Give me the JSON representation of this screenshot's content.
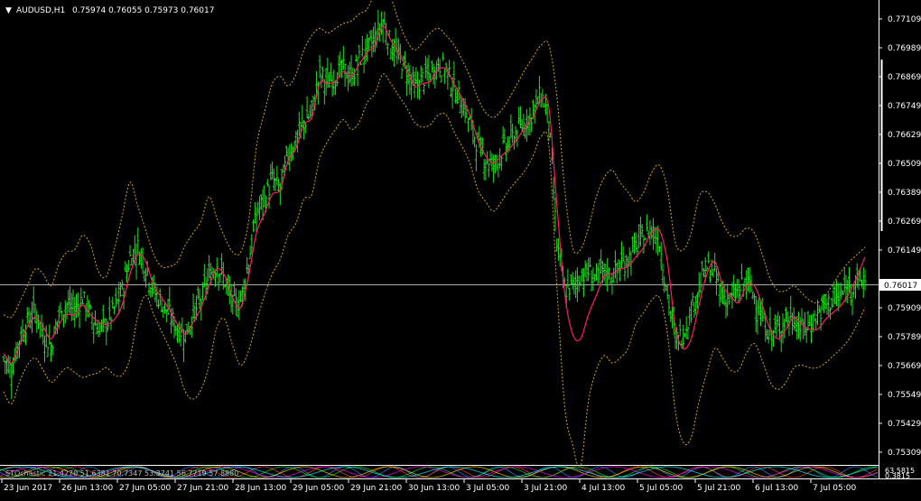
{
  "header": {
    "symbol_label": "AUDUSD,H1",
    "ohlc": "0.75974 0.76055 0.75973 0.76017",
    "dropdown_glyph": "▼"
  },
  "colors": {
    "background": "#000000",
    "candles": "#22dd22",
    "ma_line": "#ff1a6b",
    "bands": "#d8a520",
    "axis_text": "#ffffff",
    "grid_line": "#aaaaaa"
  },
  "price_axis": {
    "labels": [
      "0.77109",
      "0.76989",
      "0.76869",
      "0.76749",
      "0.76629",
      "0.76509",
      "0.76389",
      "0.76269",
      "0.76149",
      "0.75909",
      "0.75789",
      "0.75669",
      "0.75549",
      "0.75429",
      "0.75309"
    ],
    "current_price": "0.76017"
  },
  "time_axis": {
    "labels": [
      "23 Jun 2017",
      "26 Jun 13:00",
      "27 Jun 05:00",
      "27 Jun 21:00",
      "28 Jun 13:00",
      "29 Jun 05:00",
      "29 Jun 21:00",
      "30 Jun 13:00",
      "3 Jul 05:00",
      "3 Jul 21:00",
      "4 Jul 13:00",
      "5 Jul 05:00",
      "5 Jul 21:00",
      "6 Jul 13:00",
      "7 Jul 05:00"
    ]
  },
  "sub_indicator": {
    "text": "STOchastic 21.4270 51.6381 70.7347 53.3741 56.7719 57.8880",
    "right_top": "63.5815",
    "right_bottom": "0.3815"
  },
  "chart_data": {
    "type": "line",
    "title": "AUDUSD,H1",
    "y_ticks": [
      0.77109,
      0.76989,
      0.76869,
      0.76749,
      0.76629,
      0.76509,
      0.76389,
      0.76269,
      0.76149,
      0.75909,
      0.75789,
      0.75669,
      0.75549,
      0.75429,
      0.75309
    ],
    "ylim": [
      0.7526,
      0.7718
    ],
    "current_price": 0.76017,
    "series": [
      {
        "name": "ma",
        "type": "line",
        "values": [
          0.7572,
          0.7568,
          0.7575,
          0.7583,
          0.7587,
          0.7583,
          0.7578,
          0.7584,
          0.7588,
          0.7588,
          0.7592,
          0.7588,
          0.7585,
          0.7584,
          0.7586,
          0.7592,
          0.7605,
          0.7613,
          0.761,
          0.76,
          0.7595,
          0.759,
          0.7584,
          0.758,
          0.7585,
          0.7591,
          0.76,
          0.7607,
          0.7604,
          0.7595,
          0.7591,
          0.7604,
          0.7622,
          0.763,
          0.7638,
          0.764,
          0.7652,
          0.7657,
          0.7667,
          0.767,
          0.7684,
          0.7684,
          0.7685,
          0.7689,
          0.7687,
          0.7692,
          0.7697,
          0.77,
          0.7708,
          0.7702,
          0.7697,
          0.769,
          0.7683,
          0.7684,
          0.7685,
          0.769,
          0.769,
          0.7684,
          0.7678,
          0.7671,
          0.7661,
          0.7654,
          0.7651,
          0.7654,
          0.7657,
          0.7661,
          0.7666,
          0.767,
          0.7677,
          0.7674,
          0.7634,
          0.7597,
          0.758,
          0.7578,
          0.7588,
          0.7596,
          0.7604,
          0.7605,
          0.7607,
          0.7608,
          0.7612,
          0.7616,
          0.7622,
          0.7623,
          0.761,
          0.7583,
          0.7574,
          0.7578,
          0.7592,
          0.7605,
          0.761,
          0.76,
          0.7596,
          0.7593,
          0.76,
          0.76,
          0.7592,
          0.7582,
          0.7578,
          0.7582,
          0.7587,
          0.7584,
          0.7582,
          0.7582,
          0.7586,
          0.7589,
          0.7592,
          0.7597,
          0.7604,
          0.7612
        ]
      },
      {
        "name": "upper_band",
        "type": "line",
        "values": [
          0.7588,
          0.7587,
          0.7593,
          0.76,
          0.7607,
          0.7605,
          0.76,
          0.7609,
          0.7614,
          0.7615,
          0.7621,
          0.7617,
          0.7606,
          0.7604,
          0.7615,
          0.7629,
          0.7643,
          0.7633,
          0.7623,
          0.7613,
          0.7608,
          0.7608,
          0.761,
          0.7617,
          0.7622,
          0.7627,
          0.7637,
          0.7628,
          0.762,
          0.7614,
          0.7614,
          0.7627,
          0.7658,
          0.7672,
          0.7684,
          0.7687,
          0.7683,
          0.7688,
          0.7698,
          0.7704,
          0.7707,
          0.7705,
          0.7707,
          0.7709,
          0.771,
          0.7713,
          0.7715,
          0.7722,
          0.7728,
          0.772,
          0.771,
          0.7702,
          0.7698,
          0.7701,
          0.7705,
          0.7707,
          0.7704,
          0.77,
          0.7694,
          0.7687,
          0.7678,
          0.7672,
          0.767,
          0.7673,
          0.7678,
          0.7684,
          0.769,
          0.7695,
          0.77,
          0.77,
          0.7679,
          0.764,
          0.7616,
          0.7615,
          0.7624,
          0.7637,
          0.7645,
          0.7648,
          0.7643,
          0.7639,
          0.7635,
          0.7639,
          0.7647,
          0.765,
          0.764,
          0.7618,
          0.7615,
          0.7622,
          0.7637,
          0.7639,
          0.7634,
          0.7626,
          0.7621,
          0.7621,
          0.7624,
          0.7622,
          0.7613,
          0.7603,
          0.7598,
          0.7598,
          0.76,
          0.7597,
          0.7594,
          0.7593,
          0.7596,
          0.7601,
          0.7606,
          0.761,
          0.7613,
          0.7616
        ]
      },
      {
        "name": "lower_band",
        "type": "line",
        "values": [
          0.7556,
          0.7551,
          0.756,
          0.7567,
          0.757,
          0.7565,
          0.756,
          0.7563,
          0.7566,
          0.7564,
          0.7562,
          0.7563,
          0.7564,
          0.7566,
          0.7563,
          0.7563,
          0.757,
          0.7588,
          0.7596,
          0.7588,
          0.7581,
          0.7574,
          0.7566,
          0.7556,
          0.7553,
          0.7557,
          0.7567,
          0.7583,
          0.7586,
          0.7575,
          0.7567,
          0.7573,
          0.7585,
          0.7596,
          0.7605,
          0.7611,
          0.7621,
          0.7626,
          0.7636,
          0.7638,
          0.7653,
          0.766,
          0.7665,
          0.7669,
          0.7665,
          0.7668,
          0.7676,
          0.768,
          0.7688,
          0.7684,
          0.7679,
          0.7674,
          0.7668,
          0.7666,
          0.7667,
          0.7671,
          0.7671,
          0.7664,
          0.7658,
          0.7651,
          0.764,
          0.7635,
          0.7631,
          0.7635,
          0.764,
          0.7644,
          0.7648,
          0.7654,
          0.7662,
          0.7658,
          0.76,
          0.755,
          0.7534,
          0.7525,
          0.7552,
          0.7565,
          0.7571,
          0.7568,
          0.757,
          0.7574,
          0.7584,
          0.7589,
          0.7594,
          0.7595,
          0.758,
          0.7548,
          0.7535,
          0.7537,
          0.7552,
          0.7564,
          0.7574,
          0.757,
          0.7565,
          0.7565,
          0.7572,
          0.7576,
          0.7569,
          0.756,
          0.7557,
          0.756,
          0.7566,
          0.7567,
          0.7566,
          0.7566,
          0.7568,
          0.7571,
          0.7574,
          0.7578,
          0.7584,
          0.7591
        ]
      },
      {
        "name": "close",
        "type": "bar_ohlc",
        "values": [
          0.757,
          0.7565,
          0.7578,
          0.7585,
          0.759,
          0.758,
          0.7575,
          0.7588,
          0.7592,
          0.759,
          0.7595,
          0.7588,
          0.7582,
          0.7584,
          0.759,
          0.7598,
          0.7612,
          0.7616,
          0.7608,
          0.7598,
          0.7593,
          0.7588,
          0.7582,
          0.758,
          0.7588,
          0.7594,
          0.7604,
          0.7609,
          0.7602,
          0.7592,
          0.7594,
          0.761,
          0.763,
          0.7636,
          0.7644,
          0.764,
          0.7655,
          0.766,
          0.7668,
          0.7672,
          0.7688,
          0.7684,
          0.7688,
          0.769,
          0.7686,
          0.7694,
          0.7698,
          0.7703,
          0.771,
          0.77,
          0.7695,
          0.769,
          0.7682,
          0.7686,
          0.7688,
          0.7692,
          0.769,
          0.7682,
          0.7676,
          0.7668,
          0.7658,
          0.7653,
          0.765,
          0.7656,
          0.766,
          0.7664,
          0.7668,
          0.7672,
          0.768,
          0.767,
          0.7618,
          0.7598,
          0.76,
          0.7604,
          0.7606,
          0.7603,
          0.7606,
          0.7604,
          0.7608,
          0.7611,
          0.7616,
          0.762,
          0.7624,
          0.7618,
          0.7596,
          0.7578,
          0.758,
          0.759,
          0.76,
          0.7608,
          0.7604,
          0.7596,
          0.7594,
          0.7598,
          0.7602,
          0.7596,
          0.7586,
          0.758,
          0.7582,
          0.7586,
          0.7586,
          0.7582,
          0.7584,
          0.7588,
          0.7592,
          0.7594,
          0.7596,
          0.76,
          0.7602,
          0.7602
        ]
      }
    ]
  }
}
